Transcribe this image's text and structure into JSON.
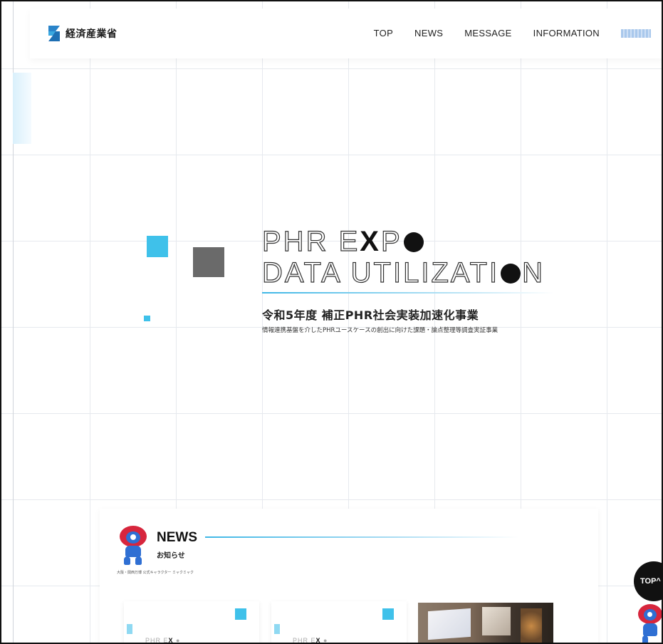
{
  "header": {
    "logo_text": "経済産業省",
    "nav": [
      "TOP",
      "NEWS",
      "MESSAGE",
      "INFORMATION"
    ]
  },
  "hero": {
    "title_line1": {
      "a": "PHR E",
      "b": "X",
      "c": "P"
    },
    "title_line2": {
      "a": "DATA UTILIZATI",
      "b": "N"
    },
    "subtitle": "令和5年度 補正PHR社会実装加速化事業",
    "description": "情報連携基盤を介したPHRユースケースの創出に向けた課題・論点整理等調査実証事業"
  },
  "news": {
    "title": "NEWS",
    "subtitle": "お知らせ",
    "mascot_caption": "大阪・関西万博 公式キャラクター ミャクミャク",
    "cards": [
      {
        "logo_a": "PHR E",
        "logo_b": "X"
      },
      {
        "logo_a": "PHR E",
        "logo_b": "X"
      }
    ]
  },
  "top_button": {
    "label": "TOP"
  },
  "colors": {
    "accent": "#3fc1ea",
    "gray_square": "#6a6a6a",
    "text": "#222222",
    "top_button_bg": "#111111"
  }
}
